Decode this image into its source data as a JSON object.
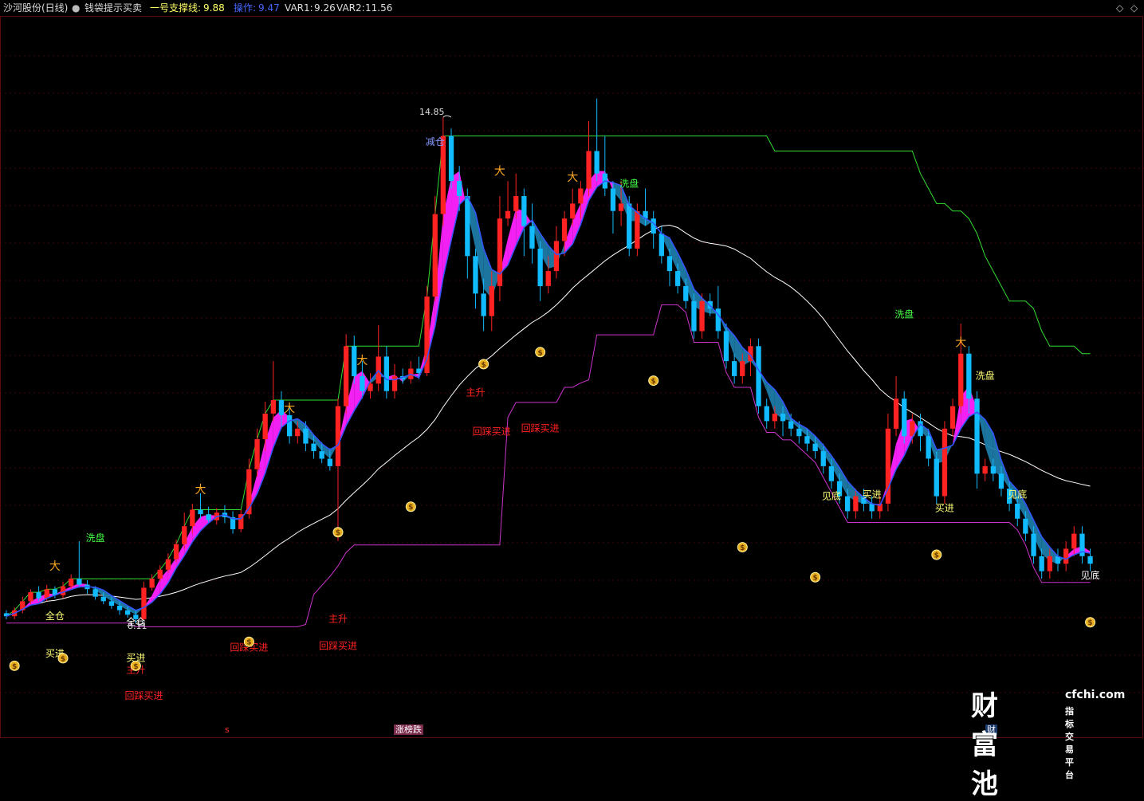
{
  "header": {
    "title": "沙河股份(日线)",
    "indicator_name": "钱袋提示买卖",
    "support_label": "一号支撑线:",
    "support_value": "9.88",
    "op_label": "操作:",
    "op_value": "9.47",
    "var1_label": "VAR1:",
    "var1_value": "9.26",
    "var2_label": "VAR2:",
    "var2_value": "11.56"
  },
  "controls": {
    "diamond": "◇",
    "more": "◇"
  },
  "price_marks": {
    "high": "14.85",
    "low": "8.11"
  },
  "watermark": {
    "brand": "财富池",
    "url": "cfchi.com",
    "sub": "指标交易平台"
  },
  "bottom_tags": [
    {
      "text": "s"
    },
    {
      "text": "涨榜跌"
    },
    {
      "text": "财"
    }
  ],
  "colors": {
    "up": "#ff2222",
    "down": "#11bbff",
    "magenta": "#ff00ff",
    "band_blue": "#1d7ba8",
    "band_pink": "#ff22ff",
    "ma_white": "#ffffff",
    "ma_blue": "#3355ff",
    "support_green": "#33dd33",
    "lower_line": "#cc33cc",
    "yellow_text": "#ffff77",
    "green_text": "#44ff44",
    "red_text": "#ff2222"
  },
  "chart_data": {
    "type": "candlestick",
    "ylim": [
      6.8,
      16.2
    ],
    "x_count": 138,
    "candles": [
      [
        8.24,
        8.2,
        8.28,
        8.16
      ],
      [
        8.2,
        8.28,
        8.32,
        8.16
      ],
      [
        8.28,
        8.4,
        8.46,
        8.24
      ],
      [
        8.4,
        8.52,
        8.56,
        8.36
      ],
      [
        8.52,
        8.44,
        8.6,
        8.4
      ],
      [
        8.44,
        8.56,
        8.62,
        8.4
      ],
      [
        8.56,
        8.48,
        8.6,
        8.44
      ],
      [
        8.48,
        8.6,
        8.66,
        8.44
      ],
      [
        8.6,
        8.7,
        8.76,
        8.56
      ],
      [
        8.7,
        8.62,
        9.2,
        8.58
      ],
      [
        8.62,
        8.56,
        8.68,
        8.5
      ],
      [
        8.56,
        8.46,
        8.6,
        8.42
      ],
      [
        8.46,
        8.4,
        8.52,
        8.36
      ],
      [
        8.4,
        8.34,
        8.46,
        8.3
      ],
      [
        8.34,
        8.28,
        8.4,
        8.22
      ],
      [
        8.28,
        8.22,
        8.34,
        8.18
      ],
      [
        8.22,
        8.16,
        8.28,
        8.11
      ],
      [
        8.16,
        8.58,
        8.66,
        8.14
      ],
      [
        8.58,
        8.7,
        8.76,
        8.54
      ],
      [
        8.7,
        8.82,
        8.88,
        8.66
      ],
      [
        8.82,
        8.96,
        9.04,
        8.78
      ],
      [
        8.96,
        9.16,
        9.22,
        8.92
      ],
      [
        9.16,
        9.4,
        9.58,
        9.1
      ],
      [
        9.4,
        9.62,
        9.7,
        9.3
      ],
      [
        9.62,
        9.56,
        9.84,
        9.5
      ],
      [
        9.56,
        9.48,
        9.66,
        9.44
      ],
      [
        9.48,
        9.58,
        9.64,
        9.42
      ],
      [
        9.58,
        9.52,
        9.68,
        9.44
      ],
      [
        9.52,
        9.36,
        9.6,
        9.3
      ],
      [
        9.36,
        9.56,
        9.62,
        9.32
      ],
      [
        9.56,
        10.16,
        10.3,
        9.5
      ],
      [
        10.16,
        10.56,
        10.7,
        10.06
      ],
      [
        10.56,
        10.9,
        11.06,
        10.4
      ],
      [
        10.9,
        11.08,
        11.6,
        10.8
      ],
      [
        11.08,
        10.88,
        11.2,
        10.7
      ],
      [
        10.88,
        10.6,
        10.98,
        10.5
      ],
      [
        10.6,
        10.7,
        10.8,
        10.5
      ],
      [
        10.7,
        10.5,
        10.8,
        10.4
      ],
      [
        10.5,
        10.4,
        10.62,
        10.3
      ],
      [
        10.4,
        10.3,
        10.52,
        10.24
      ],
      [
        10.3,
        10.2,
        10.44,
        10.14
      ],
      [
        10.2,
        11.0,
        11.1,
        9.2
      ],
      [
        11.0,
        11.8,
        11.96,
        10.9
      ],
      [
        11.8,
        11.4,
        11.94,
        11.3
      ],
      [
        11.4,
        11.2,
        11.6,
        11.1
      ],
      [
        11.2,
        11.3,
        11.44,
        11.1
      ],
      [
        11.3,
        11.66,
        12.08,
        11.2
      ],
      [
        11.66,
        11.2,
        11.8,
        11.1
      ],
      [
        11.2,
        11.4,
        11.56,
        11.1
      ],
      [
        11.4,
        11.36,
        11.5,
        11.3
      ],
      [
        11.36,
        11.5,
        11.6,
        11.3
      ],
      [
        11.5,
        11.44,
        11.66,
        11.36
      ],
      [
        11.44,
        12.46,
        12.6,
        11.4
      ],
      [
        12.46,
        13.56,
        13.8,
        12.4
      ],
      [
        13.56,
        14.6,
        14.85,
        13.4
      ],
      [
        14.6,
        14.0,
        14.7,
        13.9
      ],
      [
        14.0,
        13.8,
        14.2,
        13.6
      ],
      [
        13.8,
        13.0,
        13.9,
        12.7
      ],
      [
        13.0,
        12.5,
        13.1,
        12.3
      ],
      [
        12.5,
        12.2,
        12.7,
        12.0
      ],
      [
        12.2,
        12.6,
        12.8,
        12.0
      ],
      [
        12.6,
        13.5,
        13.8,
        12.4
      ],
      [
        13.5,
        13.6,
        14.0,
        13.4
      ],
      [
        13.6,
        13.8,
        14.1,
        13.5
      ],
      [
        13.8,
        13.4,
        13.9,
        13.0
      ],
      [
        13.4,
        13.1,
        13.7,
        12.9
      ],
      [
        13.1,
        12.6,
        13.2,
        12.4
      ],
      [
        12.6,
        12.8,
        13.0,
        12.5
      ],
      [
        12.8,
        13.2,
        13.4,
        12.7
      ],
      [
        13.2,
        13.5,
        13.6,
        13.0
      ],
      [
        13.5,
        13.7,
        13.9,
        13.4
      ],
      [
        13.7,
        13.9,
        14.0,
        13.5
      ],
      [
        13.9,
        14.4,
        14.8,
        13.8
      ],
      [
        14.4,
        14.1,
        15.1,
        14.0
      ],
      [
        14.1,
        13.9,
        14.6,
        13.8
      ],
      [
        13.9,
        13.6,
        14.0,
        13.3
      ],
      [
        13.6,
        13.7,
        14.0,
        13.4
      ],
      [
        13.7,
        13.1,
        13.8,
        13.0
      ],
      [
        13.1,
        13.6,
        13.7,
        13.0
      ],
      [
        13.6,
        13.5,
        13.9,
        13.4
      ],
      [
        13.5,
        13.3,
        13.6,
        13.1
      ],
      [
        13.3,
        13.0,
        13.4,
        12.9
      ],
      [
        13.0,
        12.8,
        13.1,
        12.6
      ],
      [
        12.8,
        12.6,
        12.9,
        12.5
      ],
      [
        12.6,
        12.4,
        12.7,
        12.3
      ],
      [
        12.4,
        12.0,
        12.5,
        11.9
      ],
      [
        12.0,
        12.4,
        12.5,
        11.9
      ],
      [
        12.4,
        12.3,
        12.5,
        12.2
      ],
      [
        12.3,
        12.0,
        12.6,
        11.9
      ],
      [
        12.0,
        11.6,
        12.1,
        11.5
      ],
      [
        11.6,
        11.4,
        11.7,
        11.3
      ],
      [
        11.4,
        11.6,
        11.7,
        11.3
      ],
      [
        11.6,
        11.8,
        11.9,
        11.4
      ],
      [
        11.8,
        11.0,
        11.9,
        10.9
      ],
      [
        11.0,
        10.8,
        11.1,
        10.7
      ],
      [
        10.8,
        10.9,
        11.0,
        10.7
      ],
      [
        10.9,
        10.8,
        11.0,
        10.6
      ],
      [
        10.8,
        10.7,
        10.9,
        10.6
      ],
      [
        10.7,
        10.6,
        10.8,
        10.5
      ],
      [
        10.6,
        10.5,
        10.7,
        10.4
      ],
      [
        10.5,
        10.4,
        10.6,
        10.3
      ],
      [
        10.4,
        10.2,
        10.5,
        10.1
      ],
      [
        10.2,
        10.0,
        10.3,
        9.9
      ],
      [
        10.0,
        9.8,
        10.1,
        9.7
      ],
      [
        9.8,
        9.6,
        9.9,
        9.5
      ],
      [
        9.6,
        9.8,
        9.9,
        9.5
      ],
      [
        9.8,
        9.7,
        9.9,
        9.6
      ],
      [
        9.7,
        9.6,
        9.8,
        9.5
      ],
      [
        9.6,
        9.7,
        9.8,
        9.5
      ],
      [
        9.7,
        10.7,
        10.9,
        9.6
      ],
      [
        10.7,
        11.1,
        11.4,
        10.6
      ],
      [
        11.1,
        10.6,
        11.2,
        10.5
      ],
      [
        10.6,
        10.8,
        10.9,
        10.5
      ],
      [
        10.8,
        10.6,
        10.9,
        10.4
      ],
      [
        10.6,
        10.3,
        10.7,
        10.2
      ],
      [
        10.3,
        9.8,
        10.4,
        9.7
      ],
      [
        9.8,
        10.7,
        10.8,
        9.7
      ],
      [
        10.7,
        11.0,
        11.1,
        10.6
      ],
      [
        11.0,
        11.7,
        12.1,
        10.9
      ],
      [
        11.7,
        11.1,
        11.8,
        10.9
      ],
      [
        11.1,
        10.1,
        11.2,
        9.9
      ],
      [
        10.1,
        10.2,
        10.3,
        10.0
      ],
      [
        10.2,
        10.1,
        10.3,
        10.0
      ],
      [
        10.1,
        9.9,
        10.2,
        9.8
      ],
      [
        9.9,
        9.7,
        10.0,
        9.6
      ],
      [
        9.7,
        9.5,
        9.8,
        9.4
      ],
      [
        9.5,
        9.3,
        9.6,
        9.2
      ],
      [
        9.3,
        9.0,
        9.4,
        8.9
      ],
      [
        9.0,
        8.8,
        9.1,
        8.7
      ],
      [
        8.8,
        9.0,
        9.1,
        8.7
      ],
      [
        9.0,
        8.9,
        9.1,
        8.8
      ],
      [
        8.9,
        9.1,
        9.2,
        8.8
      ],
      [
        9.1,
        9.3,
        9.4,
        9.0
      ],
      [
        9.3,
        9.0,
        9.4,
        8.9
      ],
      [
        9.0,
        8.9,
        9.1,
        8.8
      ]
    ],
    "annotations": [
      {
        "i": 6,
        "p": 8.16,
        "text": "全仓",
        "color": "#ffff77"
      },
      {
        "i": 6,
        "p": 7.66,
        "text": "买进",
        "color": "#ffff77"
      },
      {
        "i": 11,
        "p": 9.2,
        "text": "洗盘",
        "color": "#44ff44"
      },
      {
        "i": 16,
        "p": 7.6,
        "text": "买进",
        "color": "#ffff77"
      },
      {
        "i": 16,
        "p": 8.08,
        "text": "全仓",
        "color": "#ffffff"
      },
      {
        "i": 16,
        "p": 7.44,
        "text": "主升",
        "color": "#ff2222"
      },
      {
        "i": 17,
        "p": 7.1,
        "text": "回踩买进",
        "color": "#ff2222"
      },
      {
        "i": 30,
        "p": 7.74,
        "text": "回踩买进",
        "color": "#ff2222"
      },
      {
        "i": 41,
        "p": 8.12,
        "text": "主升",
        "color": "#ff2222"
      },
      {
        "i": 41,
        "p": 7.76,
        "text": "回踩买进",
        "color": "#ff2222"
      },
      {
        "i": 53,
        "p": 14.48,
        "text": "减仓",
        "color": "#8899ff"
      },
      {
        "i": 58,
        "p": 11.14,
        "text": "主升",
        "color": "#ff2222"
      },
      {
        "i": 60,
        "p": 10.62,
        "text": "回踩买进",
        "color": "#ff2222"
      },
      {
        "i": 66,
        "p": 10.66,
        "text": "回踩买进",
        "color": "#ff2222"
      },
      {
        "i": 77,
        "p": 13.92,
        "text": "洗盘",
        "color": "#44ff44"
      },
      {
        "i": 102,
        "p": 9.76,
        "text": "见底",
        "color": "#ffff77"
      },
      {
        "i": 107,
        "p": 9.78,
        "text": "买进",
        "color": "#ffff77"
      },
      {
        "i": 111,
        "p": 12.18,
        "text": "洗盘",
        "color": "#44ff44"
      },
      {
        "i": 116,
        "p": 9.6,
        "text": "买进",
        "color": "#ffff77"
      },
      {
        "i": 121,
        "p": 11.36,
        "text": "洗盘",
        "color": "#ffff77"
      },
      {
        "i": 125,
        "p": 9.78,
        "text": "见底",
        "color": "#ffff77"
      },
      {
        "i": 134,
        "p": 8.7,
        "text": "见底",
        "color": "#ffffff"
      }
    ],
    "moneybags": [
      {
        "i": 1,
        "p": 7.54
      },
      {
        "i": 7,
        "p": 7.64
      },
      {
        "i": 16,
        "p": 7.54
      },
      {
        "i": 30,
        "p": 7.86
      },
      {
        "i": 41,
        "p": 9.32
      },
      {
        "i": 50,
        "p": 9.66
      },
      {
        "i": 59,
        "p": 11.56
      },
      {
        "i": 66,
        "p": 11.72
      },
      {
        "i": 80,
        "p": 11.34
      },
      {
        "i": 91,
        "p": 9.12
      },
      {
        "i": 100,
        "p": 8.72
      },
      {
        "i": 115,
        "p": 9.02
      },
      {
        "i": 134,
        "p": 8.12
      }
    ],
    "runners": [
      {
        "i": 6,
        "p": 8.82
      },
      {
        "i": 24,
        "p": 9.84
      },
      {
        "i": 35,
        "p": 10.92
      },
      {
        "i": 44,
        "p": 11.56
      },
      {
        "i": 61,
        "p": 14.08
      },
      {
        "i": 70,
        "p": 14.0
      },
      {
        "i": 118,
        "p": 11.8
      }
    ]
  }
}
